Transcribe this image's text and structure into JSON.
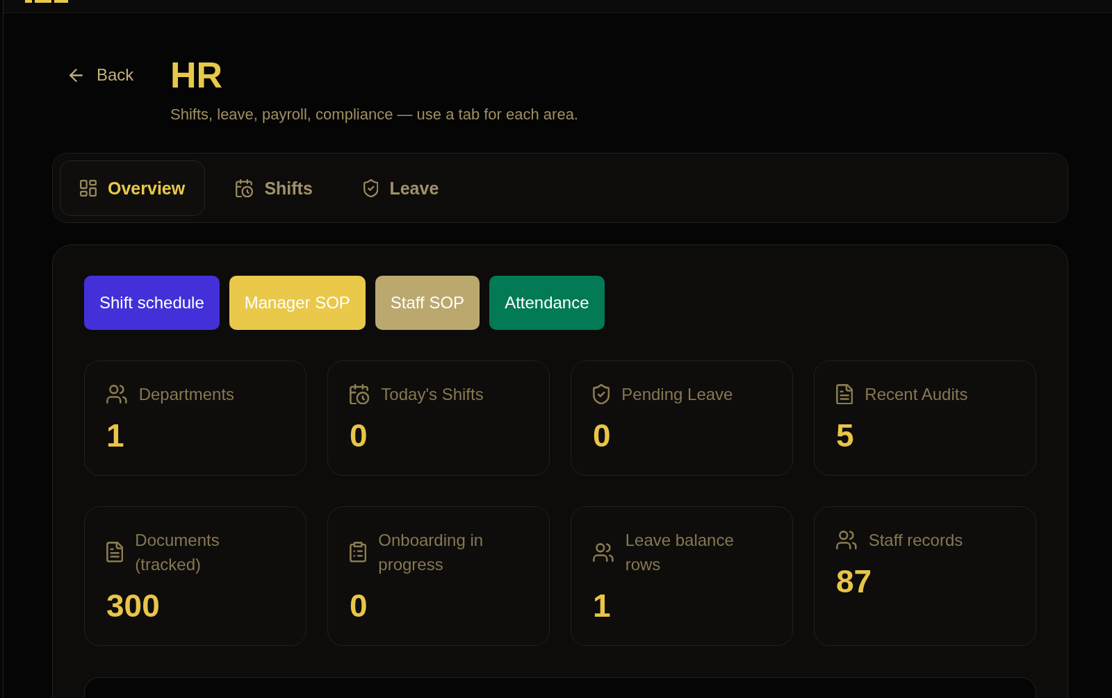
{
  "header": {
    "back": "Back",
    "title": "HR",
    "subtitle": "Shifts, leave, payroll, compliance — use a tab for each area."
  },
  "tabs": [
    {
      "label": "Overview",
      "selected": true
    },
    {
      "label": "Shifts",
      "selected": false
    },
    {
      "label": "Leave",
      "selected": false
    }
  ],
  "quick_actions": [
    {
      "label": "Shift schedule",
      "color": "#4330d9"
    },
    {
      "label": "Manager SOP",
      "color": "#e9c84a"
    },
    {
      "label": "Staff SOP",
      "color": "#bba86f"
    },
    {
      "label": "Attendance",
      "color": "#027a55"
    }
  ],
  "stats": [
    {
      "label": "Departments",
      "value": "1"
    },
    {
      "label": "Today's Shifts",
      "value": "0"
    },
    {
      "label": "Pending Leave",
      "value": "0"
    },
    {
      "label": "Recent Audits",
      "value": "5"
    },
    {
      "label": "Documents (tracked)",
      "value": "300"
    },
    {
      "label": "Onboarding in progress",
      "value": "0"
    },
    {
      "label": "Leave balance rows",
      "value": "1"
    },
    {
      "label": "Staff records",
      "value": "87"
    }
  ]
}
